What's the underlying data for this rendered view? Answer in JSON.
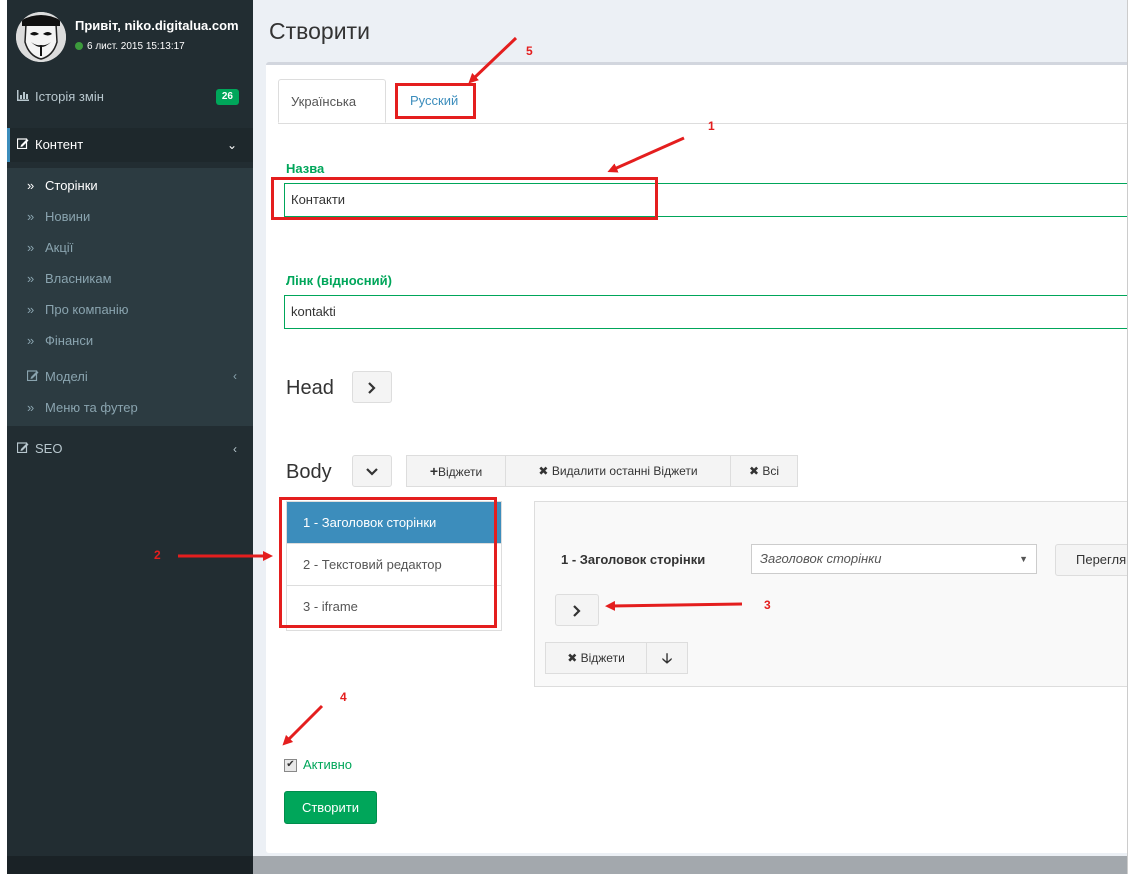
{
  "user": {
    "greeting": "Привіт, niko.digitalua.com",
    "status": "6 лист. 2015 15:13:17"
  },
  "sidebar": {
    "history": {
      "label": "Історія змін",
      "badge": "26"
    },
    "content": {
      "label": "Контент"
    },
    "submenu": [
      {
        "label": "Сторінки"
      },
      {
        "label": "Новини"
      },
      {
        "label": "Акції"
      },
      {
        "label": "Власникам"
      },
      {
        "label": "Про компанію"
      },
      {
        "label": "Фінанси"
      },
      {
        "label": "Моделі"
      },
      {
        "label": "Меню та футер"
      }
    ],
    "seo": {
      "label": "SEO"
    }
  },
  "page": {
    "title": "Створити",
    "tabs": [
      {
        "label": "Українська"
      },
      {
        "label": "Русский"
      }
    ],
    "name_label": "Назва",
    "name_value": "Контакти",
    "link_label": "Лінк (відносний)",
    "link_value": "kontakti",
    "head_label": "Head",
    "body_label": "Body",
    "widgets_add": "Віджети",
    "widgets_remove_last": "Видалити останні Віджети",
    "widgets_all": "Всі",
    "widgets_list": [
      {
        "label": "1 - Заголовок сторінки"
      },
      {
        "label": "2 - Текстовий редактор"
      },
      {
        "label": "3 - iframe"
      }
    ],
    "widget_panel": {
      "title": "1 - Заголовок сторінки",
      "select_value": "Заголовок сторінки",
      "preview": "Переглян",
      "remove_widgets": "Віджети"
    },
    "active_label": "Активно",
    "submit_label": "Створити"
  },
  "annotations": {
    "n1": "1",
    "n2": "2",
    "n3": "3",
    "n4": "4",
    "n5": "5"
  }
}
